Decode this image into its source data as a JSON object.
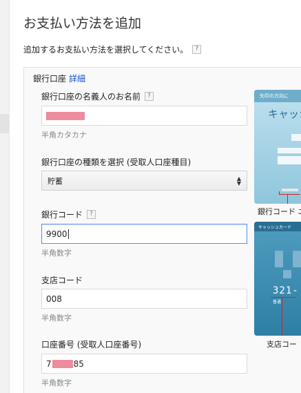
{
  "page": {
    "title": "お支払い方法を追加",
    "instruction": "追加するお支払い方法を選択してください。",
    "help_glyph": "?"
  },
  "panel": {
    "heading": "銀行口座",
    "details_link": "詳細"
  },
  "fields": {
    "holder_name": {
      "label": "銀行口座の名義人のお名前",
      "value": "",
      "hint": "半角カタカナ"
    },
    "account_type": {
      "label": "銀行口座の種類を選択 (受取人口座種目)",
      "value": "貯蓄"
    },
    "bank_code": {
      "label": "銀行コード",
      "value": "9900",
      "hint": "半角数字"
    },
    "branch_code": {
      "label": "支店コード",
      "value": "008",
      "hint": "半角数字"
    },
    "account_number": {
      "label": "口座番号 (受取人口座番号)",
      "value_prefix": "7",
      "value_suffix": "85",
      "hint": "半角数字"
    }
  },
  "illustrations": {
    "card1": {
      "band_text": "矢印の方向に",
      "brand_text": "キャッシ",
      "caption": "銀行コード ニ"
    },
    "card2": {
      "band_text": "キャッシュカード",
      "digits": "321-",
      "tag": "普通",
      "caption": "支店コー"
    }
  },
  "colors": {
    "link": "#1155cc",
    "focus_border": "#4d90fe",
    "redaction": "#ec8c9c",
    "card_marker": "#d02020"
  }
}
